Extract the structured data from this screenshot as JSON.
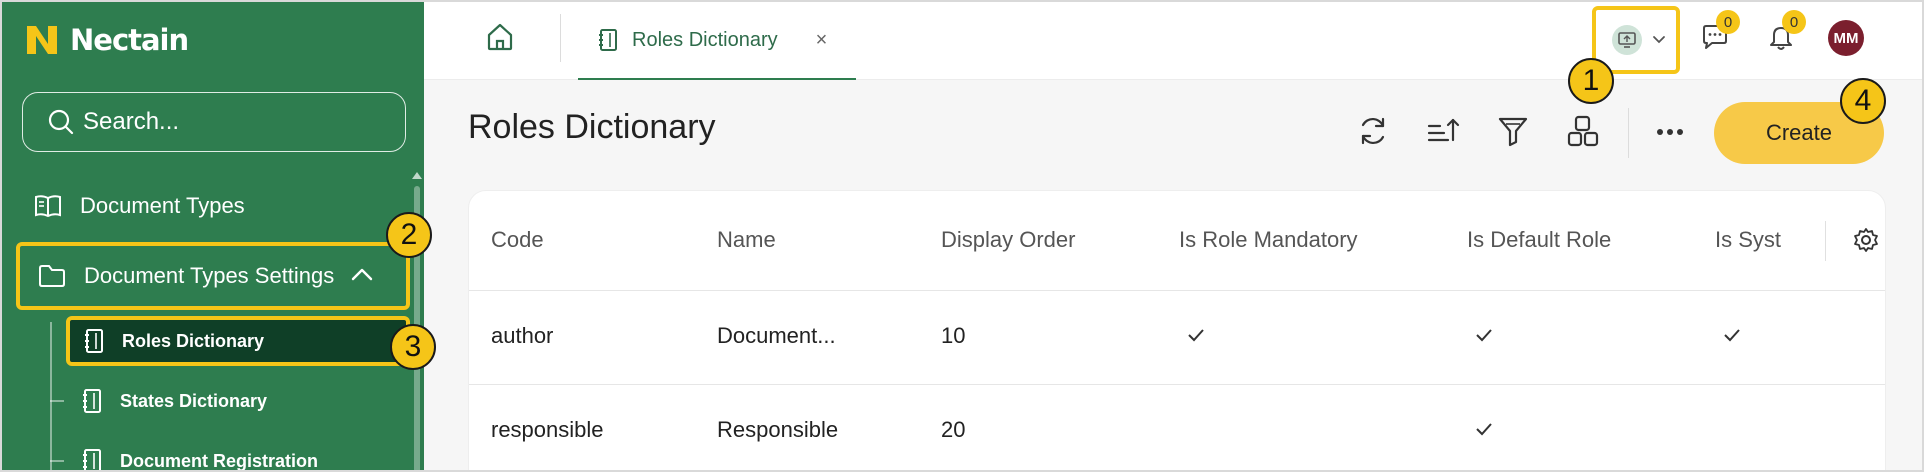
{
  "brand": {
    "name": "Nectain"
  },
  "sidebar": {
    "search_placeholder": "Search...",
    "items": [
      {
        "label": "Document Types"
      },
      {
        "label": "Document Types Settings"
      }
    ],
    "sub_items": [
      {
        "label": "Roles Dictionary"
      },
      {
        "label": "States Dictionary"
      },
      {
        "label": "Document Registration"
      }
    ]
  },
  "topbar": {
    "tab_label": "Roles Dictionary",
    "tab_close": "×",
    "messages_count": "0",
    "notifications_count": "0",
    "avatar_initials": "MM"
  },
  "callouts": [
    "1",
    "2",
    "3",
    "4"
  ],
  "main": {
    "title": "Roles Dictionary",
    "create_label": "Create"
  },
  "table": {
    "columns": [
      "Code",
      "Name",
      "Display Order",
      "Is Role Mandatory",
      "Is Default Role",
      "Is Syst"
    ],
    "rows": [
      {
        "code": "author",
        "name": "Document...",
        "display_order": "10",
        "is_role_mandatory": true,
        "is_default_role": true,
        "is_system": true
      },
      {
        "code": "responsible",
        "name": "Responsible",
        "display_order": "20",
        "is_role_mandatory": false,
        "is_default_role": true,
        "is_system": false
      }
    ]
  },
  "colors": {
    "sidebar": "#2e7d4f",
    "accent": "#f5c518",
    "create": "#f7c948",
    "avatar": "#7b1f2e"
  }
}
